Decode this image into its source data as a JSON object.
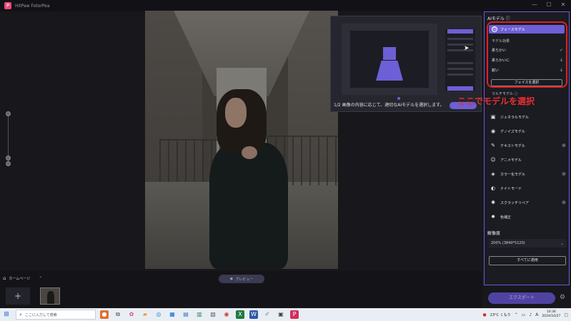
{
  "app": {
    "title": "HitPaw FotorPea",
    "window_controls": [
      "—",
      "☐",
      "✕"
    ]
  },
  "onboarding": {
    "text": "1/2 画像の内容に応じて、適切なAIモデルを選択します。"
  },
  "annotation": {
    "text": "ここでモデルを選択",
    "color": "#e02020"
  },
  "panel": {
    "title": "AIモデル ⓘ",
    "selected_model": "フェースモデル",
    "sub_label": "モデル効果",
    "options": [
      {
        "label": "柔らかい",
        "mark": "✓"
      },
      {
        "label": "柔らかいに",
        "mark": "↓"
      },
      {
        "label": "鋭い",
        "mark": "↓"
      }
    ],
    "face_button": "フェイスを選択",
    "multi_label": "マルチモデル ⓘ",
    "models": [
      {
        "label": "ジェネラルモデル",
        "icon": "image-icon",
        "glyph": "▣",
        "plus": false
      },
      {
        "label": "デノイズモデル",
        "icon": "denoise-icon",
        "glyph": "◉",
        "plus": false
      },
      {
        "label": "テキストモデル",
        "icon": "text-icon",
        "glyph": "✎",
        "plus": true
      },
      {
        "label": "アニメモデル",
        "icon": "anime-icon",
        "glyph": "☺",
        "plus": false
      },
      {
        "label": "カラー化モデル",
        "icon": "color-icon",
        "glyph": "◈",
        "plus": true
      },
      {
        "label": "ナイトモード",
        "icon": "night-icon",
        "glyph": "◐",
        "plus": false
      },
      {
        "label": "スクラッチリペア",
        "icon": "scratch-icon",
        "glyph": "✺",
        "plus": true
      },
      {
        "label": "色補正",
        "icon": "sun-icon",
        "glyph": "✹",
        "plus": false
      }
    ],
    "resolution_title": "解像度",
    "resolution_value": "200% (3840*5120)",
    "apply_all": "すべてに適用"
  },
  "export_label": "エクスポート",
  "preview_label": "プレビュー",
  "home_label": "ホームページ",
  "taskbar": {
    "search_placeholder": "ここに入力して検索",
    "weather": "23°C くもり",
    "time": "10:36",
    "date": "2024/10/27"
  },
  "accent_color": "#6d5fd6"
}
